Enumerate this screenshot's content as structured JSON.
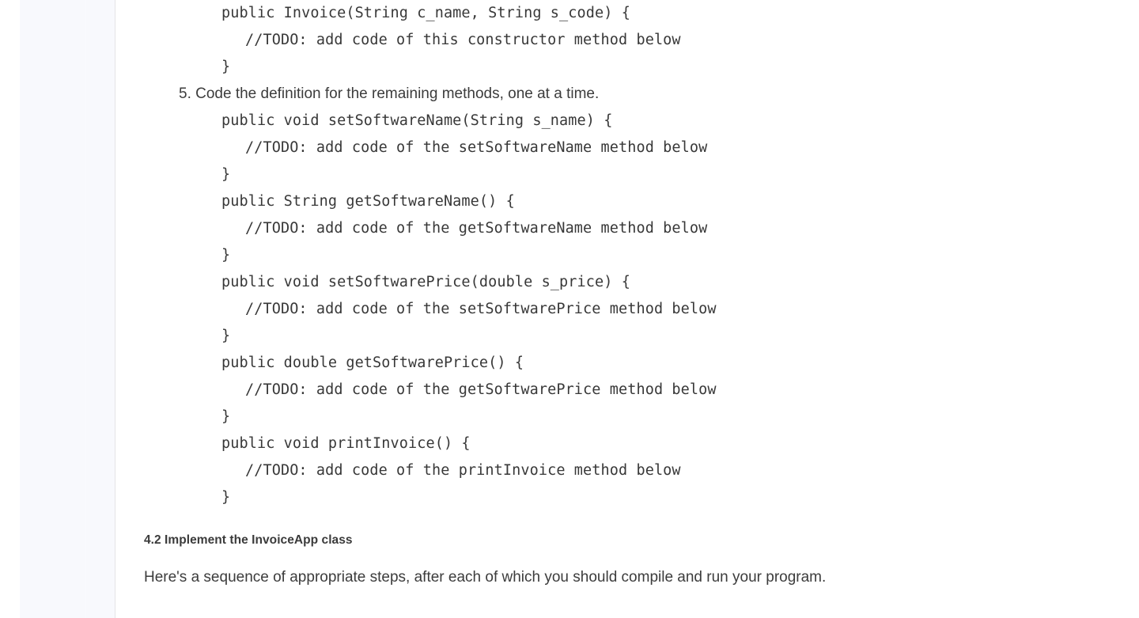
{
  "document": {
    "code_top": [
      {
        "indent": 1,
        "text": "public Invoice(String c_name, String s_code) {"
      },
      {
        "indent": 2,
        "text": "//TODO: add code of this constructor method below"
      },
      {
        "indent": 1,
        "text": "}"
      }
    ],
    "step": {
      "number": "5.",
      "text": "Code the definition for the remaining methods, one at a time."
    },
    "code_methods": [
      {
        "indent": 1,
        "text": "public void setSoftwareName(String s_name) {"
      },
      {
        "indent": 2,
        "text": "//TODO: add code of the setSoftwareName method below"
      },
      {
        "indent": 1,
        "text": "}"
      },
      {
        "indent": 1,
        "text": "public String getSoftwareName() {"
      },
      {
        "indent": 2,
        "text": "//TODO: add code of the getSoftwareName method below"
      },
      {
        "indent": 1,
        "text": "}"
      },
      {
        "indent": 1,
        "text": "public void setSoftwarePrice(double s_price) {"
      },
      {
        "indent": 2,
        "text": "//TODO: add code of the setSoftwarePrice method below"
      },
      {
        "indent": 1,
        "text": "}"
      },
      {
        "indent": 1,
        "text": "public double getSoftwarePrice() {"
      },
      {
        "indent": 2,
        "text": "//TODO: add code of the getSoftwarePrice method below"
      },
      {
        "indent": 1,
        "text": "}"
      },
      {
        "indent": 1,
        "text": "public void printInvoice() {"
      },
      {
        "indent": 2,
        "text": "//TODO: add code of the printInvoice method below"
      },
      {
        "indent": 1,
        "text": "}"
      }
    ],
    "section_heading": "4.2 Implement the InvoiceApp class",
    "paragraph": "Here's a sequence of appropriate steps, after each of which you should compile and run your program."
  },
  "sidebar": {
    "items": []
  },
  "colors": {
    "page_background": "#ffffff",
    "sidebar_background": "#f8f9fd",
    "sidebar_border": "#e4e4e6",
    "code_text": "#383838",
    "body_text": "#3c3c3c",
    "heading_text": "#3b3b3b"
  }
}
